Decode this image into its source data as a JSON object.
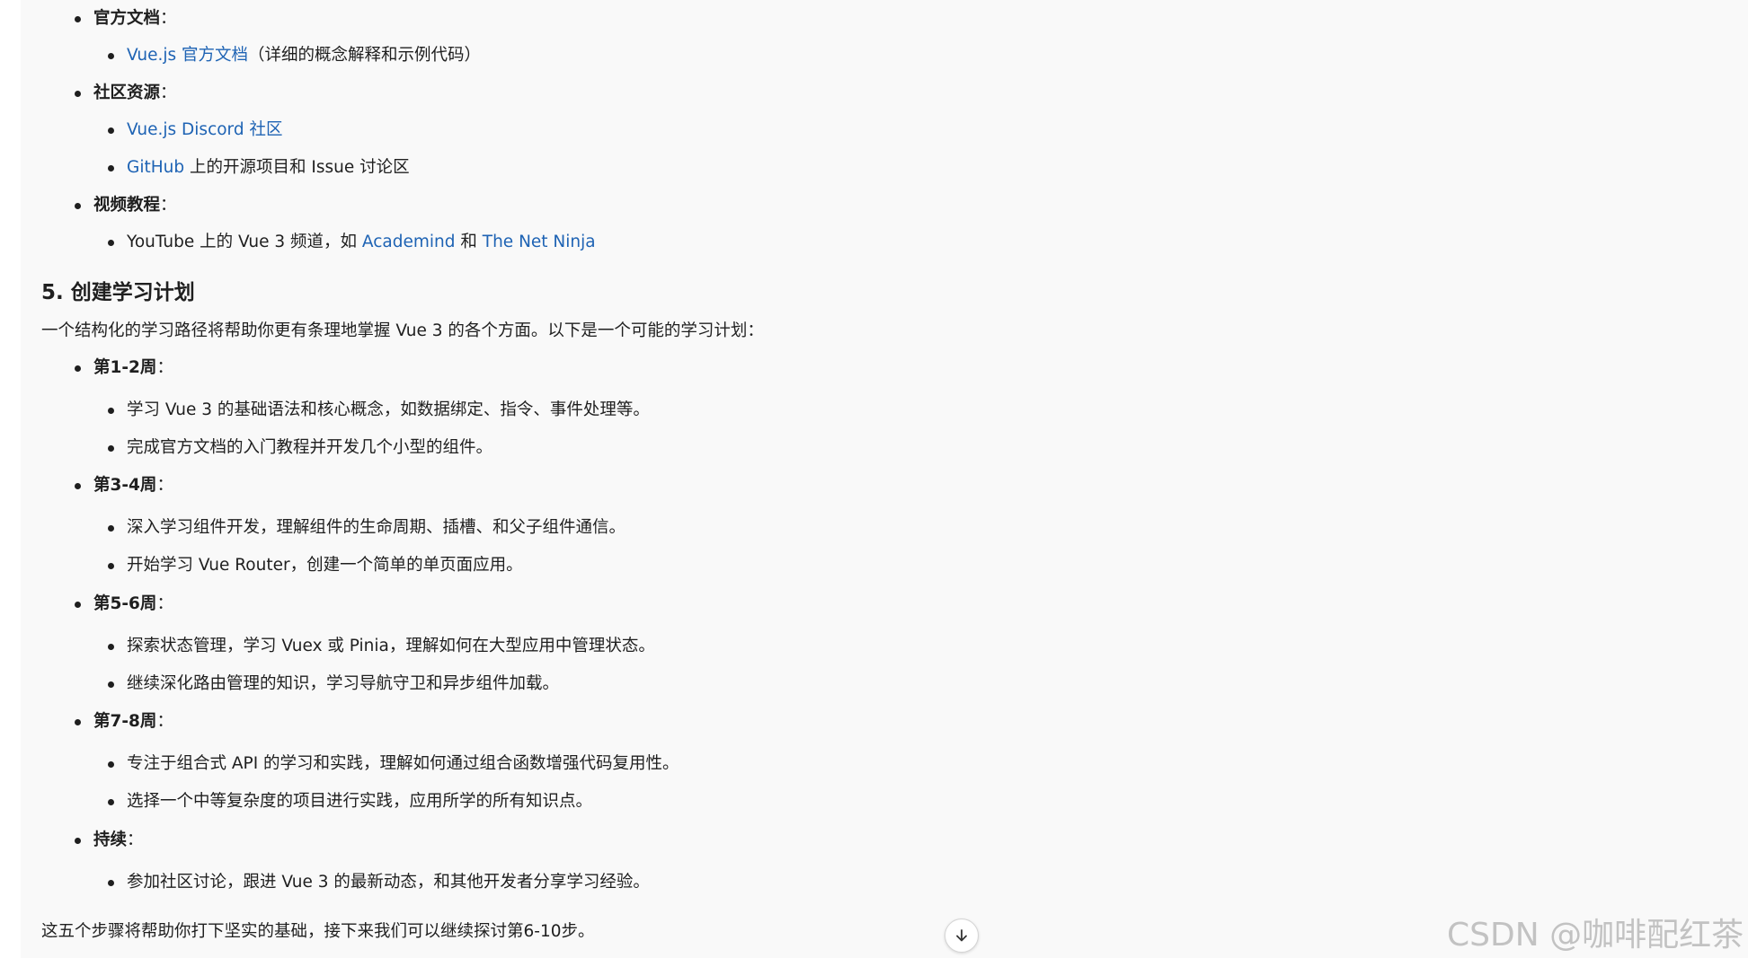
{
  "resources": {
    "official_docs": {
      "title": "官方文档",
      "link": "Vue.js 官方文档",
      "note": "（详细的概念解释和示例代码）"
    },
    "community": {
      "title": "社区资源",
      "discord_link": "Vue.js Discord 社区",
      "github_link": "GitHub",
      "github_note": " 上的开源项目和 Issue 讨论区"
    },
    "video": {
      "title": "视频教程",
      "prefix": "YouTube 上的 Vue 3 频道，如 ",
      "academind": "Academind",
      "and": " 和 ",
      "netninja": "The Net Ninja"
    }
  },
  "section5": {
    "heading": "5. 创建学习计划",
    "intro": "一个结构化的学习路径将帮助你更有条理地掌握 Vue 3 的各个方面。以下是一个可能的学习计划：",
    "weeks": [
      {
        "title": "第1-2周",
        "items": [
          "学习 Vue 3 的基础语法和核心概念，如数据绑定、指令、事件处理等。",
          "完成官方文档的入门教程并开发几个小型的组件。"
        ]
      },
      {
        "title": "第3-4周",
        "items": [
          "深入学习组件开发，理解组件的生命周期、插槽、和父子组件通信。",
          "开始学习 Vue Router，创建一个简单的单页面应用。"
        ]
      },
      {
        "title": "第5-6周",
        "items": [
          "探索状态管理，学习 Vuex 或 Pinia，理解如何在大型应用中管理状态。",
          "继续深化路由管理的知识，学习导航守卫和异步组件加载。"
        ]
      },
      {
        "title": "第7-8周",
        "items": [
          "专注于组合式 API 的学习和实践，理解如何通过组合函数增强代码复用性。",
          "选择一个中等复杂度的项目进行实践，应用所学的所有知识点。"
        ]
      },
      {
        "title": "持续",
        "items": [
          "参加社区讨论，跟进 Vue 3 的最新动态，和其他开发者分享学习经验。"
        ]
      }
    ]
  },
  "conclusion": "这五个步骤将帮助你打下坚实的基础，接下来我们可以继续探讨第6-10步。",
  "colon": "：",
  "watermark": "CSDN @咖啡配红茶",
  "icons": {
    "scroll_down": "arrow-down-icon"
  }
}
